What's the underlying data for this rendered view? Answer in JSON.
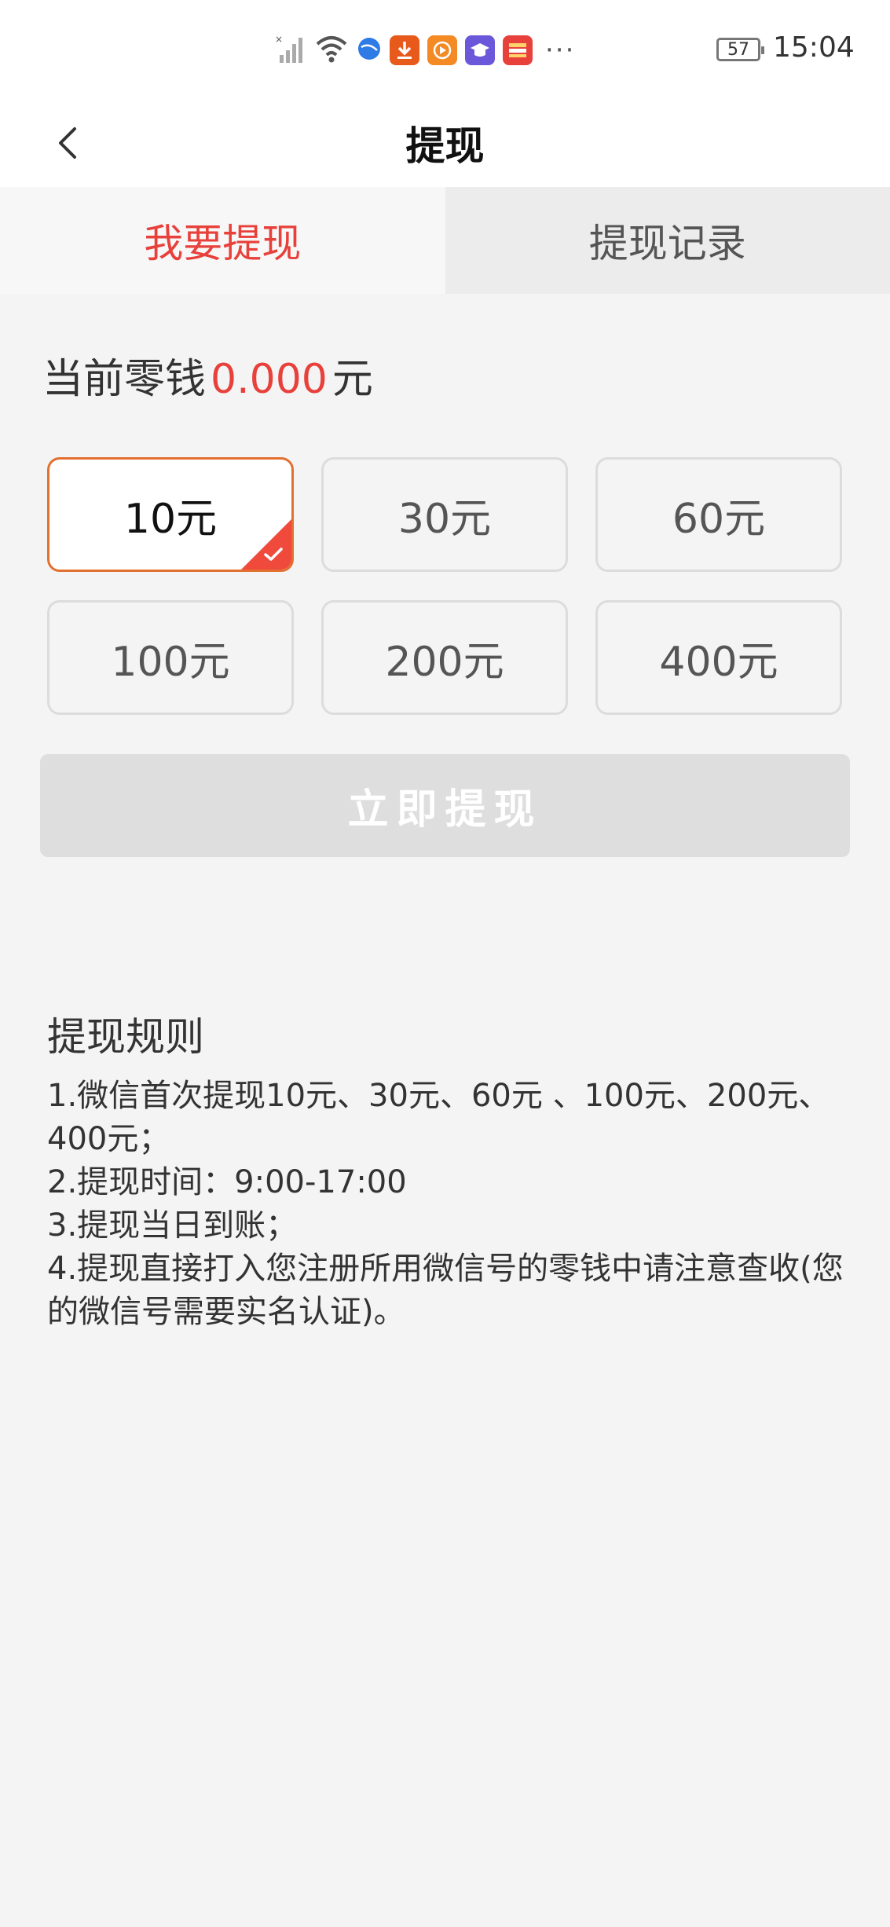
{
  "status_bar": {
    "time": "15:04",
    "battery": "57",
    "more": "···",
    "colors": {
      "download": "#e85a1b",
      "video": "#f38a24",
      "study": "#6b57d9",
      "wallet": "#e8403a"
    }
  },
  "header": {
    "title": "提现"
  },
  "tabs": [
    {
      "label": "我要提现",
      "active": true
    },
    {
      "label": "提现记录",
      "active": false
    }
  ],
  "balance": {
    "label": "当前零钱",
    "amount": "0.000",
    "unit": "元"
  },
  "options": [
    {
      "label": "10元",
      "selected": true
    },
    {
      "label": "30元",
      "selected": false
    },
    {
      "label": "60元",
      "selected": false
    },
    {
      "label": "100元",
      "selected": false
    },
    {
      "label": "200元",
      "selected": false
    },
    {
      "label": "400元",
      "selected": false
    }
  ],
  "submit": {
    "label": "立即提现"
  },
  "rules": {
    "title": "提现规则",
    "lines": [
      "1.微信首次提现10元、30元、60元 、100元、200元、400元；",
      "2.提现时间：9:00-17:00",
      "3.提现当日到账；",
      "4.提现直接打入您注册所用微信号的零钱中请注意查收(您的微信号需要实名认证)。"
    ]
  },
  "theme": {
    "accent": "#e8403a",
    "selected_border": "#e2702f"
  }
}
